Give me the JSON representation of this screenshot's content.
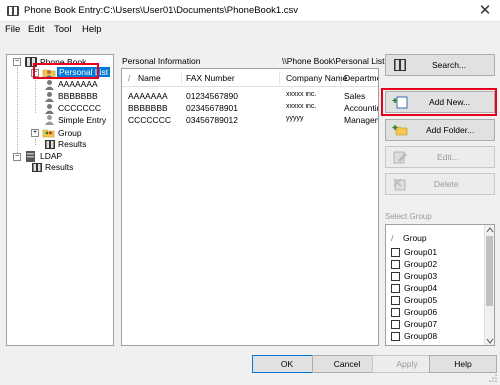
{
  "window": {
    "title": "Phone Book Entry:C:\\Users\\User01\\Documents\\PhoneBook1.csv",
    "close_glyph": "✕"
  },
  "menu": [
    {
      "label": "File",
      "key": "F"
    },
    {
      "label": "Edit",
      "key": "E"
    },
    {
      "label": "Tool",
      "key": "T"
    },
    {
      "label": "Help",
      "key": "H"
    }
  ],
  "tree": {
    "root": "Phone Book",
    "personal_list": "Personal List",
    "entries": [
      "AAAAAAA",
      "BBBBBBB",
      "CCCCCCC",
      "Simple Entry"
    ],
    "group": "Group",
    "group_results": "Results",
    "ldap": "LDAP",
    "ldap_results": "Results"
  },
  "list_panel": {
    "label": "Personal Information",
    "path": "\\\\Phone Book\\Personal List",
    "sort_glyph": "/",
    "columns": [
      "Name",
      "FAX Number",
      "Company Name",
      "Department"
    ],
    "rows": [
      [
        "AAAAAAA",
        "01234567890",
        "xxxxx inc.",
        "Sales"
      ],
      [
        "BBBBBBB",
        "02345678901",
        "xxxxx inc.",
        "Accounting"
      ],
      [
        "CCCCCCC",
        "03456789012",
        "yyyyy",
        "Management"
      ]
    ]
  },
  "buttons": {
    "search": "Search...",
    "add_new": "Add New...",
    "add_folder": "Add Folder...",
    "edit": "Edit...",
    "delete": "Delete"
  },
  "select_group": {
    "title": "Select Group",
    "header": "Group",
    "items": [
      "Group01",
      "Group02",
      "Group03",
      "Group04",
      "Group05",
      "Group06",
      "Group07",
      "Group08"
    ]
  },
  "dialog_buttons": {
    "ok": "OK",
    "cancel": "Cancel",
    "apply": "Apply",
    "help": "Help"
  },
  "colors": {
    "highlight": "#e8001c",
    "selection": "#0078d7",
    "disabled_text": "#9a9a9a"
  }
}
